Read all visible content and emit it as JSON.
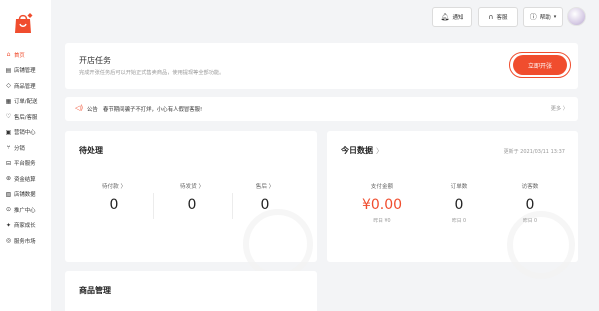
{
  "sidebar": {
    "items": [
      {
        "icon": "home-icon",
        "glyph": "⌂",
        "label": "首页",
        "active": true
      },
      {
        "icon": "store-icon",
        "glyph": "▤",
        "label": "店铺管理"
      },
      {
        "icon": "product-icon",
        "glyph": "◇",
        "label": "商品管理"
      },
      {
        "icon": "order-icon",
        "glyph": "▦",
        "label": "订单/配送"
      },
      {
        "icon": "aftersale-icon",
        "glyph": "♡",
        "label": "售后/客服"
      },
      {
        "icon": "marketing-icon",
        "glyph": "▣",
        "label": "营销中心"
      },
      {
        "icon": "share-icon",
        "glyph": "⑂",
        "label": "分销"
      },
      {
        "icon": "platform-icon",
        "glyph": "⊟",
        "label": "平台服务"
      },
      {
        "icon": "finance-icon",
        "glyph": "⊛",
        "label": "资金结算"
      },
      {
        "icon": "data-icon",
        "glyph": "▧",
        "label": "店铺数据"
      },
      {
        "icon": "promotion-icon",
        "glyph": "⊙",
        "label": "推广中心"
      },
      {
        "icon": "growth-icon",
        "glyph": "✦",
        "label": "商家成长"
      },
      {
        "icon": "service-market-icon",
        "glyph": "◎",
        "label": "服务市场"
      }
    ]
  },
  "topbar": {
    "notify_label": "通知",
    "service_label": "客服",
    "help_label": "帮助"
  },
  "task": {
    "title": "开店任务",
    "description": "完成开张任务后可以开始正式售卖商品，使用提现等全部功能。",
    "button_label": "立即开张"
  },
  "notice": {
    "label": "公告",
    "text": "春节期间骗子不打烊，小心有人假冒客服!",
    "more": "更多 〉"
  },
  "pending": {
    "title": "待处理",
    "stats": [
      {
        "label": "待付款 〉",
        "value": "0"
      },
      {
        "label": "待发货 〉",
        "value": "0"
      },
      {
        "label": "售后 〉",
        "value": "0"
      }
    ]
  },
  "today": {
    "title": "今日数据",
    "title_arrow": "〉",
    "update_time": "更新于 2021/03/11 13:37",
    "stats": [
      {
        "label": "支付金额",
        "value": "¥0.00",
        "sub": "昨日 ¥0"
      },
      {
        "label": "订单数",
        "value": "0",
        "sub": "昨日 0"
      },
      {
        "label": "访客数",
        "value": "0",
        "sub": "昨日 0"
      }
    ]
  },
  "goods": {
    "title": "商品管理"
  },
  "colors": {
    "accent": "#f04d2e",
    "background": "#f3f4f6"
  }
}
